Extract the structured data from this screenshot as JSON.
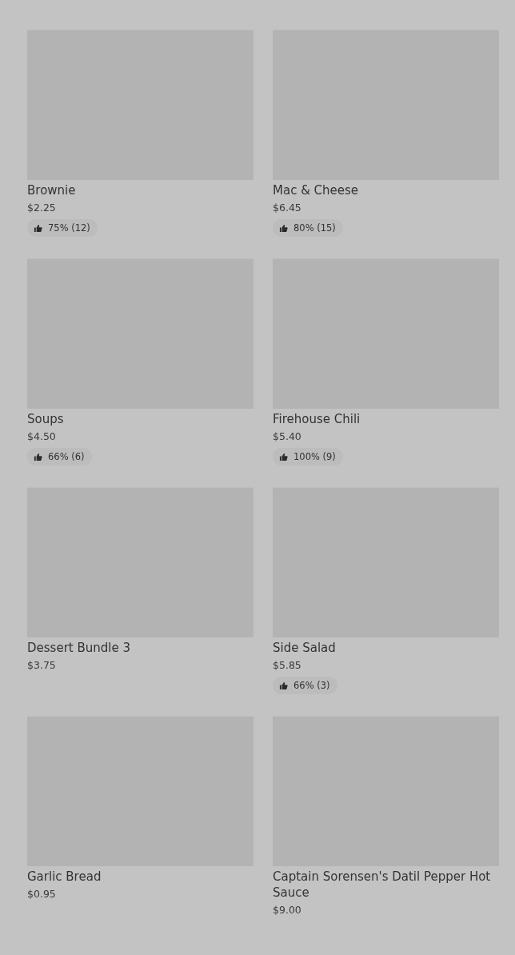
{
  "items": [
    {
      "name": "Brownie",
      "price": "$2.25",
      "rating": "75% (12)"
    },
    {
      "name": "Mac & Cheese",
      "price": "$6.45",
      "rating": "80% (15)"
    },
    {
      "name": "Soups",
      "price": "$4.50",
      "rating": "66% (6)"
    },
    {
      "name": "Firehouse Chili",
      "price": "$5.40",
      "rating": "100% (9)"
    },
    {
      "name": "Dessert Bundle 3",
      "price": "$3.75"
    },
    {
      "name": "Side Salad",
      "price": "$5.85",
      "rating": "66% (3)"
    },
    {
      "name": "Garlic Bread",
      "price": "$0.95"
    },
    {
      "name": "Captain Sorensen's Datil Pepper Hot Sauce",
      "price": "$9.00"
    }
  ]
}
